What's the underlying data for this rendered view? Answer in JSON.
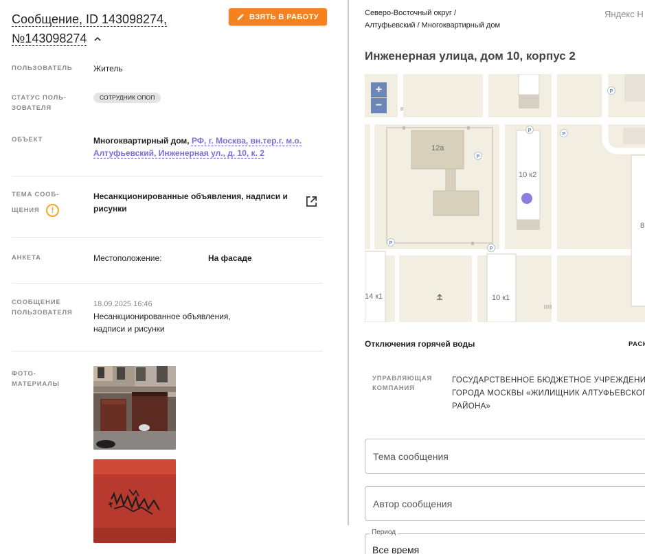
{
  "message": {
    "title": "Сообщение, ID 143098274, №143098274",
    "take_button": "ВЗЯТЬ В РАБОТУ"
  },
  "fields": {
    "user_label": "ПОЛЬЗОВАТЕЛЬ",
    "user_value": "Житель",
    "status_label_1": "СТАТУС ПОЛЬ-",
    "status_label_2": "ЗОВАТЕЛЯ",
    "status_chip": "СОТРУДНИК ОПОП",
    "object_label": "ОБЪЕКТ",
    "object_prefix": "Многоквартирный дом, ",
    "object_link_1": "РФ, г. Москва, вн.тер.г. м.о.",
    "object_link_2": "Алтуфьевский, Инженерная ул., д. 10, к. 2",
    "topic_label_1": "ТЕМА СООБ-",
    "topic_label_2": "ЩЕНИЯ",
    "topic_value_1": "Несанкционированные объявления, надписи и",
    "topic_value_2": "рисунки",
    "survey_label": "АНКЕТА",
    "survey_key": "Местоположение:",
    "survey_value": "На фасаде",
    "msg_label_1": "СООБЩЕНИЕ",
    "msg_label_2": "ПОЛЬЗОВАТЕЛЯ",
    "msg_date": "18.09.2025 16:46",
    "msg_text_1": "Несанкционированное объявления,",
    "msg_text_2": "надписи и рисунки",
    "photos_label_1": "ФОТО-",
    "photos_label_2": "МАТЕРИАЛЫ"
  },
  "location": {
    "breadcrumb_1": "Северо-Восточный округ /",
    "breadcrumb_2": "Алтуфьевский / Многоквартирный дом",
    "yandex": "Яндекс Н",
    "address": "Инженерная улица, дом 10, корпус 2",
    "map_labels": {
      "b1": "12а",
      "b2": "10 к2",
      "b3": "14 к1",
      "b4": "10 к1",
      "b5": "8",
      "zoom_in": "+",
      "zoom_out": "−",
      "parking": "P"
    }
  },
  "hot_water": {
    "label": "Отключения горячей воды",
    "action": "РАСК"
  },
  "company": {
    "label_1": "УПРАВЛЯЮЩАЯ",
    "label_2": "КОМПАНИЯ",
    "value_1": "ГОСУДАРСТВЕННОЕ БЮДЖЕТНОЕ УЧРЕЖДЕНИЕ",
    "value_2": "ГОРОДА МОСКВЫ «ЖИЛИЩНИК АЛТУФЬЕВСКОГО",
    "value_3": "РАЙОНА»"
  },
  "form": {
    "topic_placeholder": "Тема сообщения",
    "author_placeholder": "Автор сообщения",
    "period_label": "Период",
    "period_value": "Все время"
  },
  "colors": {
    "accent": "#f5821f",
    "link": "#7b6fd6",
    "warning": "#f5a623"
  }
}
